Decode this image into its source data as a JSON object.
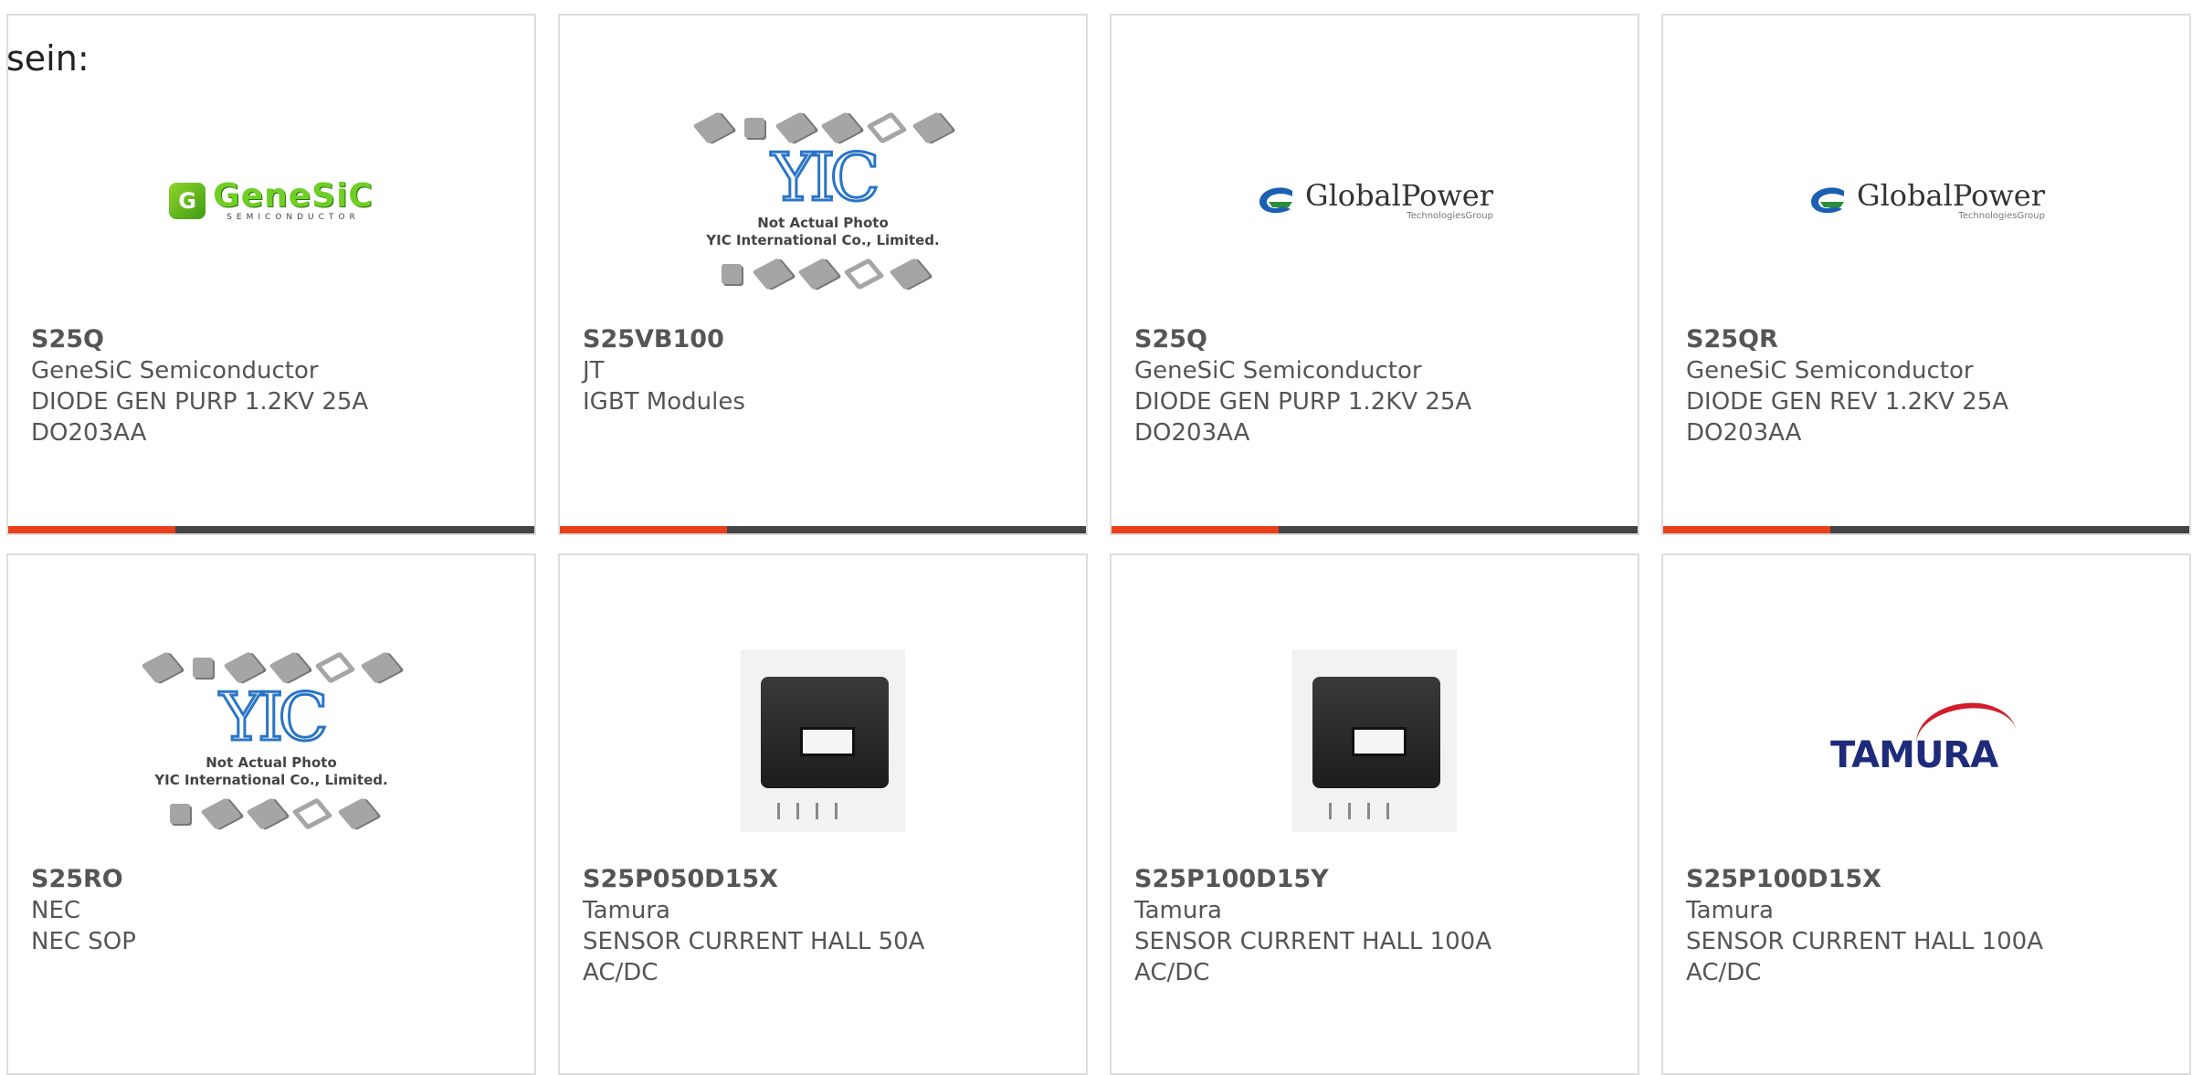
{
  "intro_text": "sein:",
  "products": [
    {
      "part": "S25Q",
      "manufacturer": "GeneSiC Semiconductor",
      "description": "DIODE GEN PURP 1.2KV 25A",
      "package": "DO203AA",
      "image": "genesic-logo",
      "logo_text": "GeneSiC",
      "logo_sub": "SEMICONDUCTOR"
    },
    {
      "part": "S25VB100",
      "manufacturer": "JT",
      "description": "IGBT Modules",
      "package": "",
      "image": "yic-placeholder",
      "logo_text": "YIC",
      "caption_1": "Not Actual Photo",
      "caption_2": "YIC International Co., Limited."
    },
    {
      "part": "S25Q",
      "manufacturer": "GeneSiC Semiconductor",
      "description": "DIODE GEN PURP 1.2KV 25A",
      "package": "DO203AA",
      "image": "globalpower-logo",
      "logo_text": "GlobalPower",
      "logo_sub": "TechnologiesGroup"
    },
    {
      "part": "S25QR",
      "manufacturer": "GeneSiC Semiconductor",
      "description": "DIODE GEN REV 1.2KV 25A",
      "package": "DO203AA",
      "image": "globalpower-logo",
      "logo_text": "GlobalPower",
      "logo_sub": "TechnologiesGroup"
    },
    {
      "part": "S25RO",
      "manufacturer": "NEC",
      "description": "NEC SOP",
      "package": "",
      "image": "yic-placeholder",
      "logo_text": "YIC",
      "caption_1": "Not Actual Photo",
      "caption_2": "YIC International Co., Limited."
    },
    {
      "part": "S25P050D15X",
      "manufacturer": "Tamura",
      "description": "SENSOR CURRENT HALL 50A",
      "package": "AC/DC",
      "image": "current-sensor-photo"
    },
    {
      "part": "S25P100D15Y",
      "manufacturer": "Tamura",
      "description": "SENSOR CURRENT HALL 100A",
      "package": "AC/DC",
      "image": "current-sensor-photo"
    },
    {
      "part": "S25P100D15X",
      "manufacturer": "Tamura",
      "description": "SENSOR CURRENT HALL 100A",
      "package": "AC/DC",
      "image": "tamura-logo",
      "logo_text": "TAMURA"
    }
  ],
  "colors": {
    "accent": "#e8401c",
    "bar": "#444444",
    "card_border": "#dddddd",
    "text": "#555555"
  }
}
